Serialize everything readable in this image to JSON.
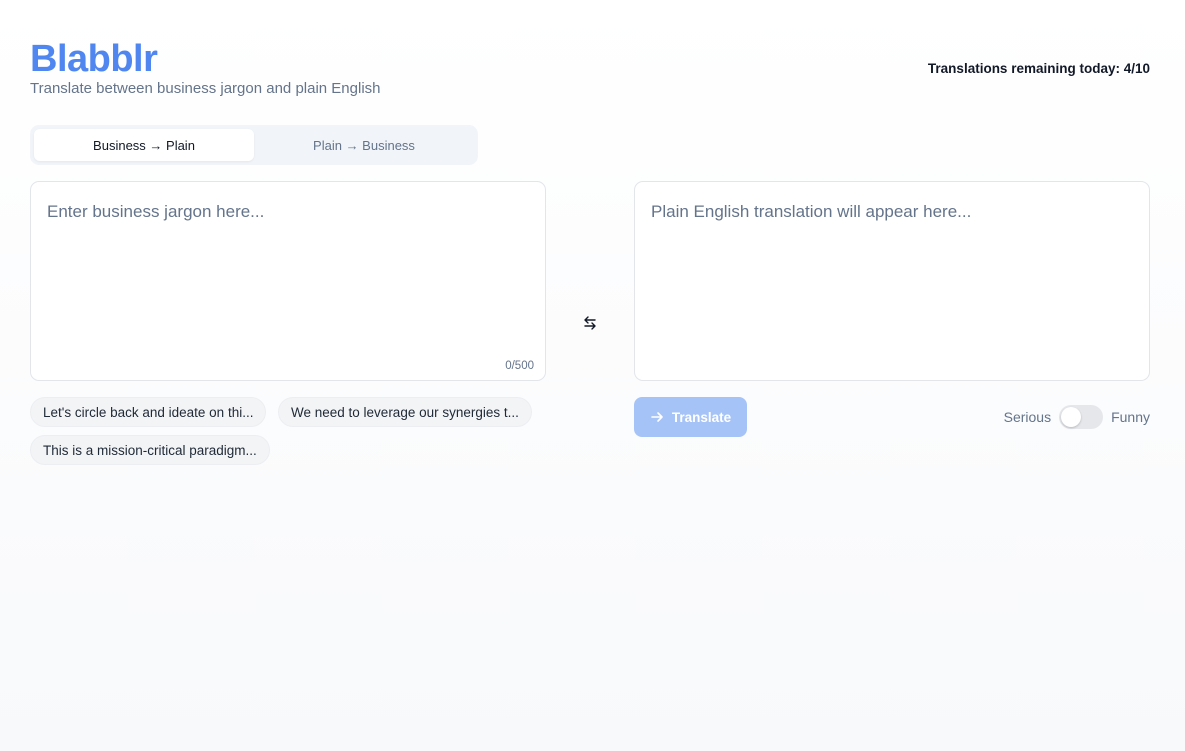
{
  "app": {
    "name": "Blabblr",
    "tagline": "Translate between business jargon and plain English"
  },
  "quota": {
    "text": "Translations remaining today: 4/10"
  },
  "mode_tabs": [
    {
      "label": "Business → Plain",
      "active": true
    },
    {
      "label": "Plain → Business",
      "active": false
    }
  ],
  "input": {
    "value": "",
    "placeholder": "Enter business jargon here...",
    "char_count": "0/500"
  },
  "output": {
    "placeholder": "Plain English translation will appear here..."
  },
  "suggestions": [
    "Let's circle back and ideate on thi...",
    "We need to leverage our synergies t...",
    "This is a mission-critical paradigm..."
  ],
  "actions": {
    "translate_label": "Translate",
    "swap_icon": "swap-arrows-icon"
  },
  "tone": {
    "left_label": "Serious",
    "right_label": "Funny",
    "value": "Serious"
  },
  "colors": {
    "brand": "#4f86f0",
    "translate_disabled": "#a6c3f8"
  }
}
